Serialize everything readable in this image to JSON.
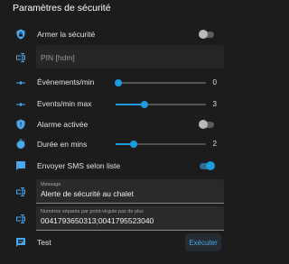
{
  "header": {
    "title": "Paramètres de sécurité"
  },
  "rows": {
    "arm": {
      "label": "Armer la sécurité",
      "icon": "shield-lock-icon",
      "state": "off"
    },
    "pin": {
      "placeholder": "PIN [hdm]",
      "icon": "form-textbox-icon"
    },
    "events_min": {
      "label": "Évènements/min",
      "icon": "ray-vertex-icon",
      "value": "0",
      "fraction": 0
    },
    "events_max": {
      "label": "Events/min max",
      "icon": "ray-vertex-icon",
      "value": "3",
      "fraction": 0.3
    },
    "alarm": {
      "label": "Alarme activée",
      "icon": "shield-alert-icon",
      "state": "off"
    },
    "duration": {
      "label": "Durée en mins",
      "icon": "timer-icon",
      "value": "2",
      "fraction": 0.2
    },
    "sms": {
      "label": "Envoyer SMS selon liste",
      "icon": "message-icon",
      "state": "on"
    },
    "message": {
      "label": "Message",
      "value": "Alerte de sécurité au chalet",
      "icon": "form-textbox-icon"
    },
    "numbers": {
      "label": "Numéros séparés par point-virgule pas de plus",
      "value": "0041793650313;0041795523040",
      "icon": "form-textbox-icon"
    },
    "test": {
      "label": "Test",
      "icon": "message-text-icon",
      "button": "Exécuter"
    }
  },
  "colors": {
    "accent": "#1e9ae0",
    "icon": "#4aa8ec",
    "background": "#1c1c1c"
  }
}
